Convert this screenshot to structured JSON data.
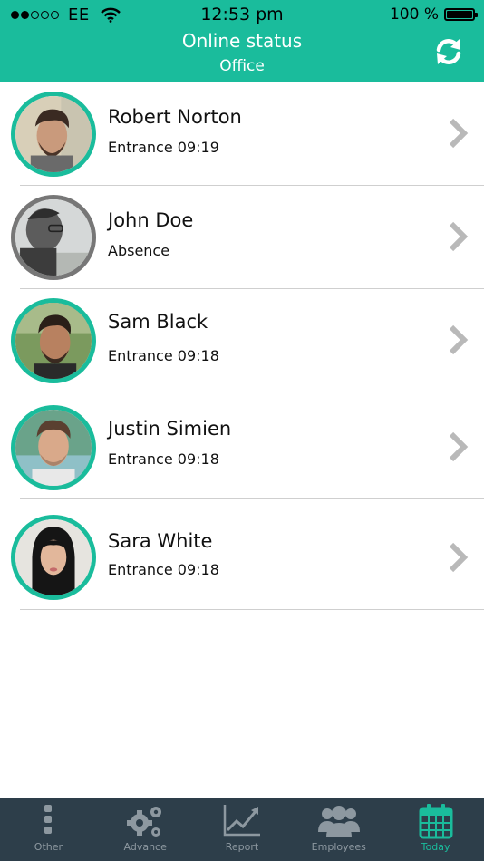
{
  "status_bar": {
    "carrier": "EE",
    "time": "12:53 pm",
    "battery": "100 %"
  },
  "header": {
    "title": "Online status",
    "subtitle": "Office",
    "refresh_icon": "refresh-icon"
  },
  "employees": [
    {
      "name": "Robert Norton",
      "status": "Entrance 09:19",
      "online": true
    },
    {
      "name": "John Doe",
      "status": "Absence",
      "online": false
    },
    {
      "name": "Sam Black",
      "status": "Entrance 09:18",
      "online": true
    },
    {
      "name": "Justin Simien",
      "status": "Entrance 09:18",
      "online": true
    },
    {
      "name": "Sara White",
      "status": "Entrance 09:18",
      "online": true
    }
  ],
  "tabs": [
    {
      "label": "Other",
      "icon": "more-vertical-icon",
      "active": false
    },
    {
      "label": "Advance",
      "icon": "gears-icon",
      "active": false
    },
    {
      "label": "Report",
      "icon": "line-chart-icon",
      "active": false
    },
    {
      "label": "Employees",
      "icon": "users-icon",
      "active": false
    },
    {
      "label": "Today",
      "icon": "calendar-icon",
      "active": true
    }
  ],
  "colors": {
    "accent": "#1abc9c",
    "tabbar": "#2d3e4a",
    "absent_ring": "#777777",
    "chevron": "#b9b9b9"
  }
}
